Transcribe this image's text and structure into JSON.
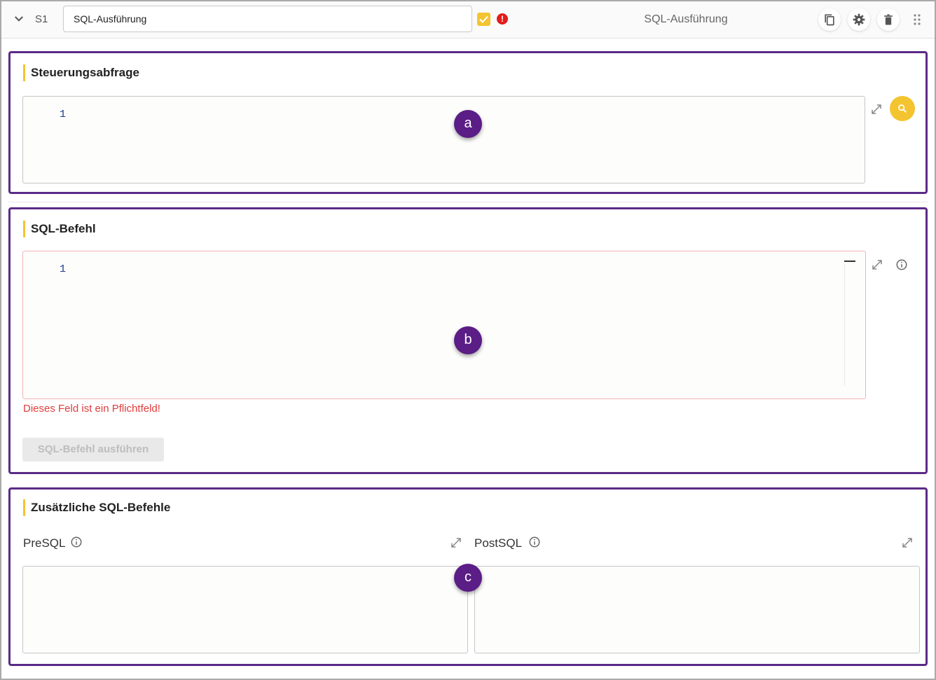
{
  "header": {
    "step_label": "S1",
    "name_value": "SQL-Ausführung",
    "title": "SQL-Ausführung",
    "error_glyph": "!"
  },
  "sections": {
    "control": {
      "title": "Steuerungsabfrage",
      "line_number": "1",
      "badge": "a"
    },
    "sql": {
      "title": "SQL-Befehl",
      "line_number": "1",
      "badge": "b",
      "error_message": "Dieses Feld ist ein Pflichtfeld!",
      "run_button": "SQL-Befehl ausführen"
    },
    "extra": {
      "title": "Zusätzliche SQL-Befehle",
      "presql_label": "PreSQL",
      "postsql_label": "PostSQL",
      "badge": "c"
    }
  },
  "colors": {
    "accent_purple": "#5b2a86",
    "accent_yellow": "#f4c430",
    "error_red": "#e03c3c"
  }
}
